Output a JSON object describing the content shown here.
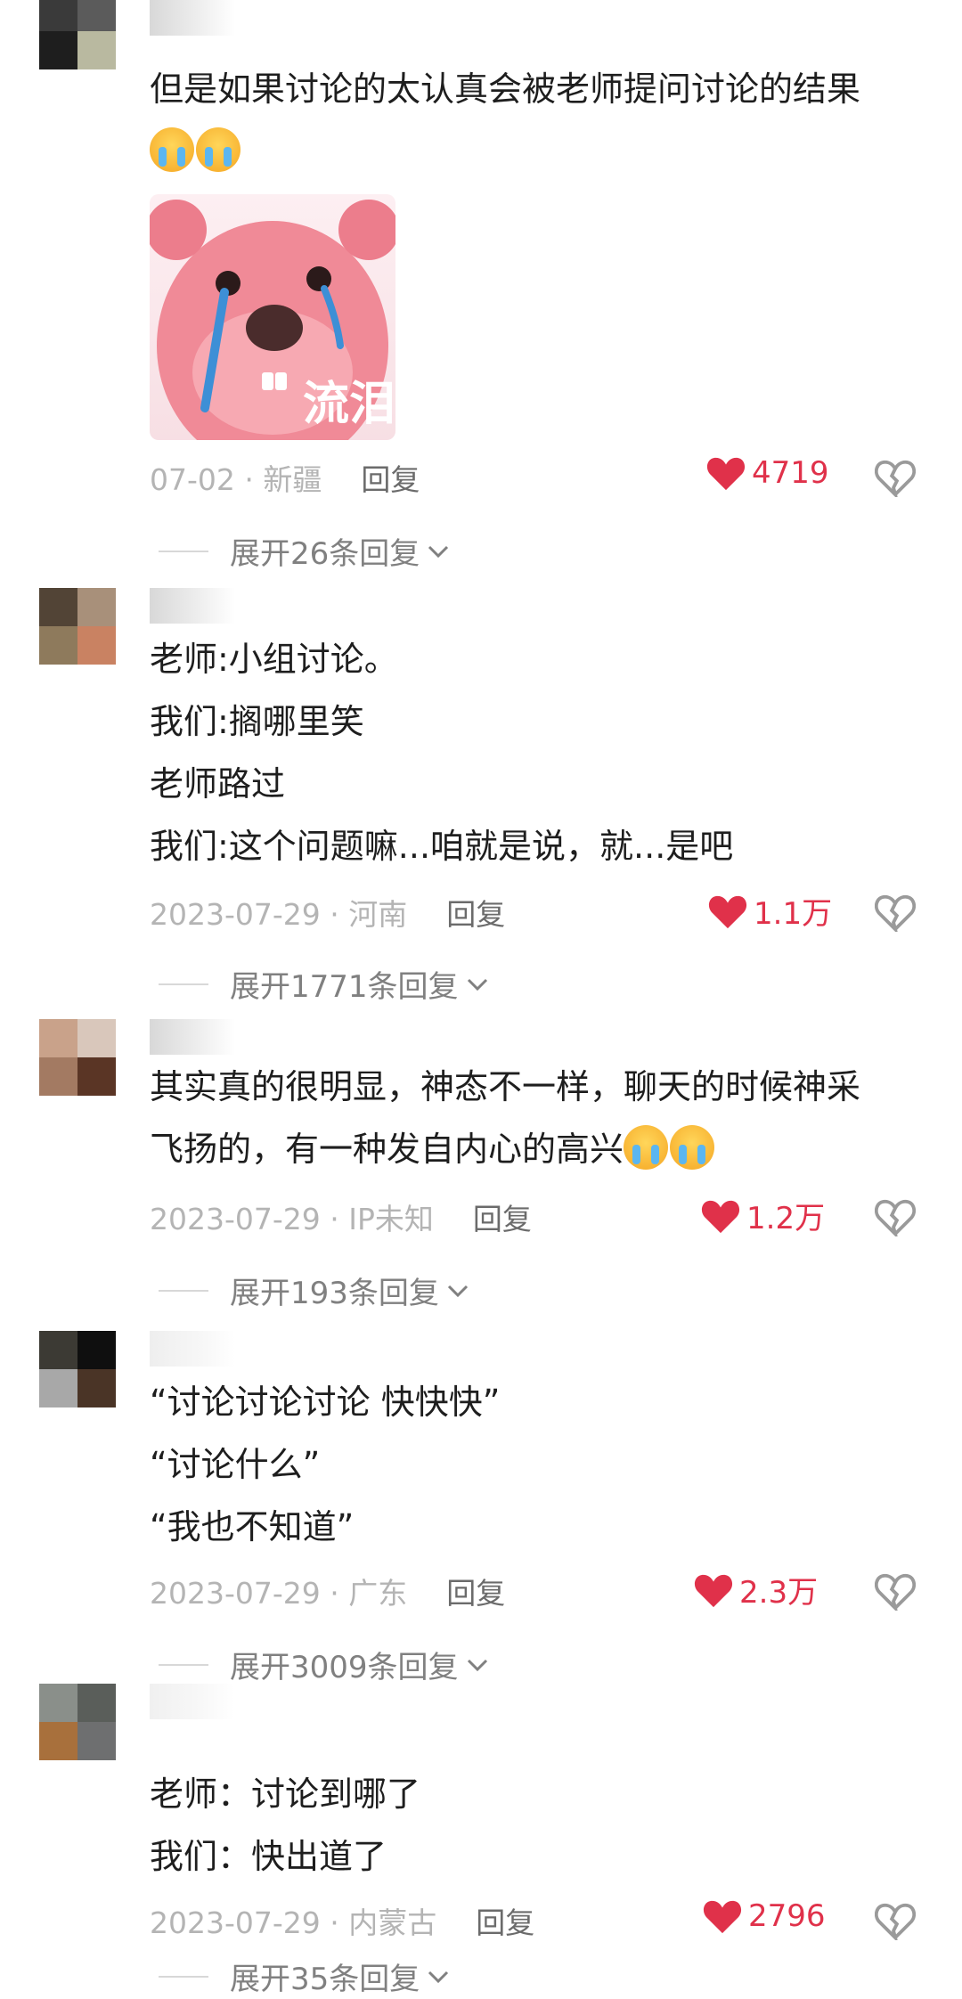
{
  "comments": [
    {
      "text_lines": [
        "但是如果讨论的太认真会被老师提问讨论的结果"
      ],
      "emoji_count": 2,
      "sticker_text": "流泪",
      "date": "07-02",
      "location": "新疆",
      "reply_label": "回复",
      "likes": "4719",
      "expand_label": "展开26条回复"
    },
    {
      "text_lines": [
        "老师:小组讨论。",
        "我们:搁哪里笑",
        "老师路过",
        "我们:这个问题嘛...咱就是说，就...是吧"
      ],
      "date": "2023-07-29",
      "location": "河南",
      "reply_label": "回复",
      "likes": "1.1万",
      "expand_label": "展开1771条回复"
    },
    {
      "text_lines": [
        "其实真的很明显，神态不一样，聊天的时候神采",
        "飞扬的，有一种发自内心的高兴"
      ],
      "date": "2023-07-29",
      "location": "IP未知",
      "reply_label": "回复",
      "likes": "1.2万",
      "expand_label": "展开193条回复"
    },
    {
      "text_lines": [
        "“讨论讨论讨论 快快快”",
        "“讨论什么”",
        "“我也不知道”"
      ],
      "date": "2023-07-29",
      "location": "广东",
      "reply_label": "回复",
      "likes": "2.3万",
      "expand_label": "展开3009条回复"
    },
    {
      "text_lines": [
        "老师：讨论到哪了",
        "我们：快出道了"
      ],
      "date": "2023-07-29",
      "location": "内蒙古",
      "reply_label": "回复",
      "likes": "2796",
      "expand_label": "展开35条回复"
    }
  ],
  "meta_separator": " · ",
  "colors": {
    "like_red": "#e0314a",
    "meta_gray": "#b4b4b4",
    "reply_gray": "#6b6b6b"
  }
}
